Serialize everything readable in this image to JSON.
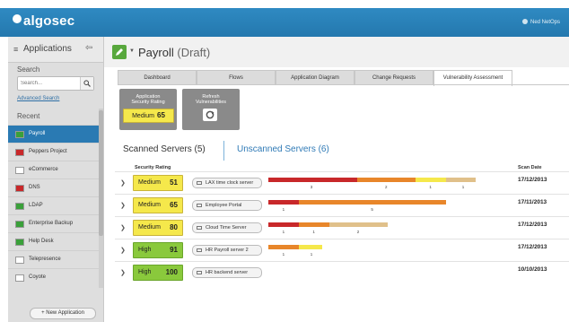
{
  "colors": {
    "brand": "#2a7ab3",
    "medium": "#f5e84b",
    "high": "#8ac93c",
    "critical": "#c8282a",
    "orange": "#e8862a",
    "tan": "#e0c08a"
  },
  "brand": {
    "name": "algosec"
  },
  "user": {
    "name": "Ned NetOps"
  },
  "sidebar": {
    "title": "Applications",
    "search_label": "Search",
    "search_placeholder": "Search...",
    "advanced_search": "Advanced Search",
    "recent_label": "Recent",
    "recent": [
      {
        "label": "Payroll",
        "color": "#3aa03a",
        "active": true
      },
      {
        "label": "Peppers Project",
        "color": "#c8282a",
        "active": false
      },
      {
        "label": "eCommerce",
        "color": "#ffffff",
        "active": false
      },
      {
        "label": "DNS",
        "color": "#c8282a",
        "active": false
      },
      {
        "label": "LDAP",
        "color": "#3aa03a",
        "active": false
      },
      {
        "label": "Enterprise Backup",
        "color": "#3aa03a",
        "active": false
      },
      {
        "label": "Help Desk",
        "color": "#3aa03a",
        "active": false
      },
      {
        "label": "Telepresence",
        "color": "#ffffff",
        "active": false
      },
      {
        "label": "Coyote",
        "color": "#ffffff",
        "active": false
      }
    ],
    "new_app": "+ New Application"
  },
  "header": {
    "title": "Payroll",
    "status": "(Draft)"
  },
  "tabs": [
    {
      "label": "Dashboard",
      "active": false
    },
    {
      "label": "Flows",
      "active": false
    },
    {
      "label": "Application Diagram",
      "active": false
    },
    {
      "label": "Change Requests",
      "active": false
    },
    {
      "label": "Vulnerability Assessment",
      "active": true
    }
  ],
  "cards": {
    "rating": {
      "caption1": "Application",
      "caption2": "Security Rating",
      "level": "Medium",
      "value": "65"
    },
    "refresh": {
      "caption1": "Refresh",
      "caption2": "Vulnerabilities"
    }
  },
  "servers": {
    "scanned_label": "Scanned Servers (5)",
    "unscanned_label": "Unscanned Servers (6)",
    "col_security": "Security Rating",
    "col_date": "Scan Date",
    "rows": [
      {
        "level": "Medium",
        "score": "51",
        "server": "LAX time clock server",
        "date": "17/12/2013",
        "segments": [
          {
            "color": "#c8282a",
            "w": 0.38
          },
          {
            "color": "#e8862a",
            "w": 0.25
          },
          {
            "color": "#f5e84b",
            "w": 0.13
          },
          {
            "color": "#e0c08a",
            "w": 0.13
          }
        ],
        "ticks": [
          {
            "pos": 0.18,
            "label": "3"
          },
          {
            "pos": 0.5,
            "label": "2"
          },
          {
            "pos": 0.69,
            "label": "1"
          },
          {
            "pos": 0.83,
            "label": "1"
          }
        ]
      },
      {
        "level": "Medium",
        "score": "65",
        "server": "Employee Portal",
        "date": "17/11/2013",
        "segments": [
          {
            "color": "#c8282a",
            "w": 0.13
          },
          {
            "color": "#e8862a",
            "w": 0.63
          }
        ],
        "ticks": [
          {
            "pos": 0.06,
            "label": "1"
          },
          {
            "pos": 0.44,
            "label": "5"
          }
        ]
      },
      {
        "level": "Medium",
        "score": "80",
        "server": "Cloud Time Server",
        "date": "17/12/2013",
        "segments": [
          {
            "color": "#c8282a",
            "w": 0.13
          },
          {
            "color": "#e8862a",
            "w": 0.13
          },
          {
            "color": "#e0c08a",
            "w": 0.25
          }
        ],
        "ticks": [
          {
            "pos": 0.06,
            "label": "1"
          },
          {
            "pos": 0.19,
            "label": "1"
          },
          {
            "pos": 0.38,
            "label": "2"
          }
        ]
      },
      {
        "level": "High",
        "score": "91",
        "server": "HR Payroll server 2",
        "date": "17/12/2013",
        "segments": [
          {
            "color": "#e8862a",
            "w": 0.13
          },
          {
            "color": "#f5e84b",
            "w": 0.1
          }
        ],
        "ticks": [
          {
            "pos": 0.06,
            "label": "1"
          },
          {
            "pos": 0.18,
            "label": "1"
          }
        ]
      },
      {
        "level": "High",
        "score": "100",
        "server": "HR backend server",
        "date": "10/10/2013",
        "segments": [],
        "ticks": []
      }
    ]
  }
}
